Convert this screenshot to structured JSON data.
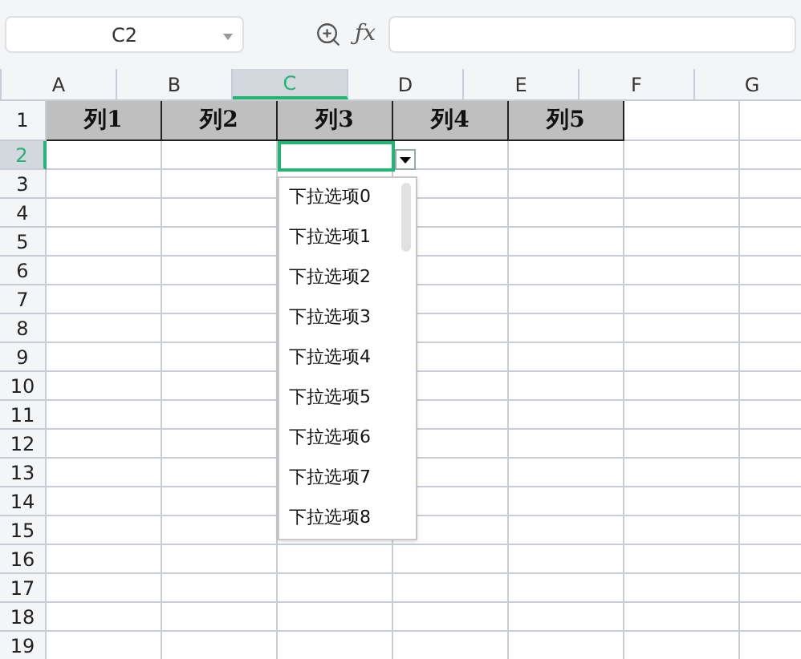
{
  "name_box": {
    "value": "C2"
  },
  "formula_bar": {
    "function_label": "ƒx"
  },
  "columns": [
    {
      "label": "A",
      "selected": false
    },
    {
      "label": "B",
      "selected": false
    },
    {
      "label": "C",
      "selected": true
    },
    {
      "label": "D",
      "selected": false
    },
    {
      "label": "E",
      "selected": false
    },
    {
      "label": "F",
      "selected": false
    },
    {
      "label": "G",
      "selected": false
    }
  ],
  "rows": [
    {
      "label": "1",
      "selected": false,
      "cells": [
        "列1",
        "列2",
        "列3",
        "列4",
        "列5"
      ]
    },
    {
      "label": "2",
      "selected": true,
      "cells": []
    },
    {
      "label": "3",
      "selected": false,
      "cells": []
    },
    {
      "label": "4",
      "selected": false,
      "cells": []
    },
    {
      "label": "5",
      "selected": false,
      "cells": []
    },
    {
      "label": "6",
      "selected": false,
      "cells": []
    },
    {
      "label": "7",
      "selected": false,
      "cells": []
    },
    {
      "label": "8",
      "selected": false,
      "cells": []
    },
    {
      "label": "9",
      "selected": false,
      "cells": []
    },
    {
      "label": "10",
      "selected": false,
      "cells": []
    },
    {
      "label": "11",
      "selected": false,
      "cells": []
    },
    {
      "label": "12",
      "selected": false,
      "cells": []
    },
    {
      "label": "13",
      "selected": false,
      "cells": []
    },
    {
      "label": "14",
      "selected": false,
      "cells": []
    },
    {
      "label": "15",
      "selected": false,
      "cells": []
    },
    {
      "label": "16",
      "selected": false,
      "cells": []
    },
    {
      "label": "17",
      "selected": false,
      "cells": []
    },
    {
      "label": "18",
      "selected": false,
      "cells": []
    },
    {
      "label": "19",
      "selected": false,
      "cells": []
    }
  ],
  "dropdown": {
    "items": [
      "下拉选项0",
      "下拉选项1",
      "下拉选项2",
      "下拉选项3",
      "下拉选项4",
      "下拉选项5",
      "下拉选项6",
      "下拉选项7",
      "下拉选项8"
    ]
  }
}
